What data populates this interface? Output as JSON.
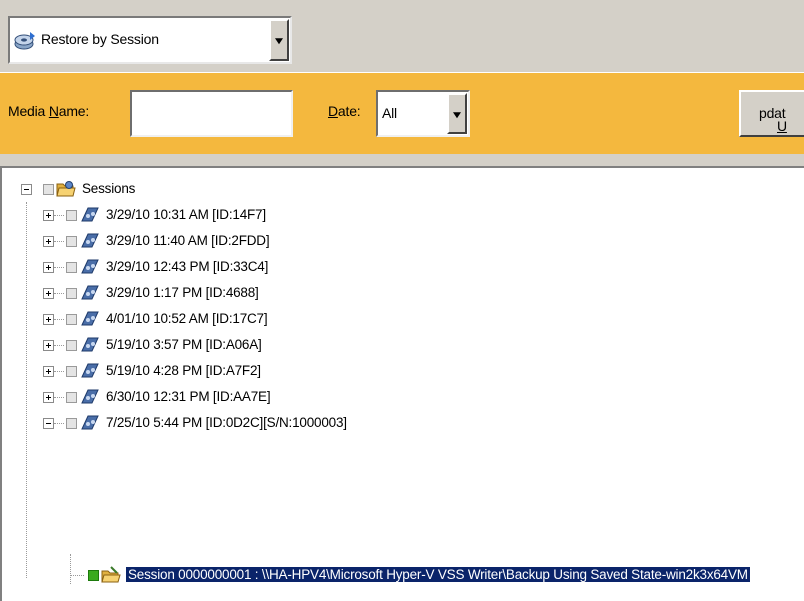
{
  "toolbar": {
    "restore_mode": "Restore by Session"
  },
  "filter": {
    "media_name_label": "Media Name:",
    "media_name_value": "",
    "date_label": "Date:",
    "date_value": "All",
    "update_label": "Updat"
  },
  "tree": {
    "root": {
      "label": "Sessions",
      "expanded": true
    },
    "sessions": [
      {
        "label": "3/29/10 10:31 AM [ID:14F7]",
        "expanded": false
      },
      {
        "label": "3/29/10 11:40 AM [ID:2FDD]",
        "expanded": false
      },
      {
        "label": "3/29/10 12:43 PM [ID:33C4]",
        "expanded": false
      },
      {
        "label": "3/29/10 1:17 PM [ID:4688]",
        "expanded": false
      },
      {
        "label": "4/01/10 10:52 AM [ID:17C7]",
        "expanded": false
      },
      {
        "label": "5/19/10 3:57 PM [ID:A06A]",
        "expanded": false
      },
      {
        "label": "5/19/10 4:28 PM [ID:A7F2]",
        "expanded": false
      },
      {
        "label": "6/30/10 12:31 PM [ID:AA7E]",
        "expanded": false
      },
      {
        "label": "7/25/10 5:44 PM [ID:0D2C][S/N:1000003]",
        "expanded": true
      }
    ],
    "child": {
      "label": "Session 0000000001 : \\\\HA-HPV4\\Microsoft Hyper-V VSS Writer\\Backup Using Saved State-win2k3x64VM",
      "selected": true,
      "checked": true
    }
  },
  "colors": {
    "filter_bar": "#f4b83e",
    "chrome": "#d4d0c8",
    "selection": "#0a246a",
    "check_green": "#3aaa1e"
  },
  "icons": {
    "restore_mode": "restore-disk-icon",
    "root": "sessions-folder-icon",
    "session": "tape-session-icon",
    "child": "writer-folder-icon"
  }
}
